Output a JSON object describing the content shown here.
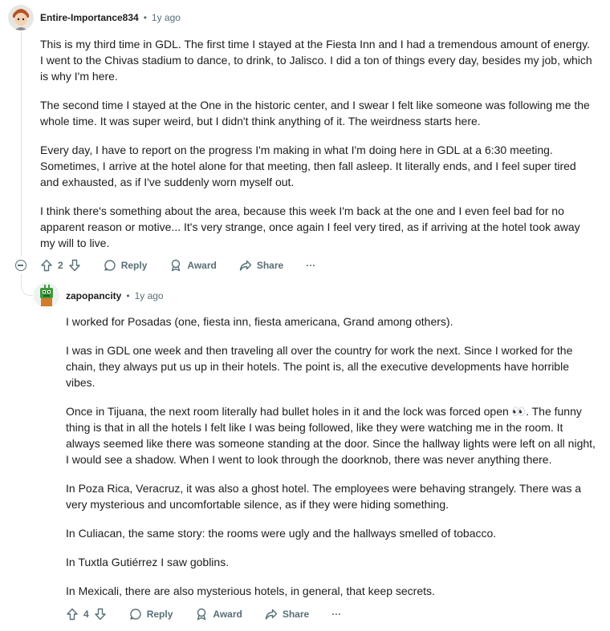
{
  "comment1": {
    "author": "Entire-Importance834",
    "separator": "•",
    "time": "1y ago",
    "paragraphs": [
      "This is my third time in GDL. The first time I stayed at the Fiesta Inn and I had a tremendous amount of energy. I went to the Chivas stadium to dance, to drink, to Jalisco. I did a ton of things every day, besides my job, which is why I'm here.",
      "The second time I stayed at the One in the historic center, and I swear I felt like someone was following me the whole time. It was super weird, but I didn't think anything of it. The weirdness starts here.",
      "Every day, I have to report on the progress I'm making in what I'm doing here in GDL at a 6:30 meeting. Sometimes, I arrive at the hotel alone for that meeting, then fall asleep. It literally ends, and I feel super tired and exhausted, as if I've suddenly worn myself out.",
      "I think there's something about the area, because this week I'm back at the one and I even feel bad for no apparent reason or motive... It's very strange, once again I feel very tired, as if arriving at the hotel took away my will to live."
    ],
    "votes": "2",
    "reply_label": "Reply",
    "award_label": "Award",
    "share_label": "Share",
    "more_label": "···"
  },
  "comment2": {
    "author": "zapopancity",
    "separator": "•",
    "time": "1y ago",
    "paragraphs": [
      "I worked for Posadas (one, fiesta inn, fiesta americana, Grand among others).",
      "I was in GDL one week and then traveling all over the country for work the next. Since I worked for the chain, they always put us up in their hotels. The point is, all the executive developments have horrible vibes.",
      "Once in Tijuana, the next room literally had bullet holes in it and the lock was forced open 👀. The funny thing is that in all the hotels I felt like I was being followed, like they were watching me in the room. It always seemed like there was someone standing at the door. Since the hallway lights were left on all night, I would see a shadow. When I went to look through the doorknob, there was never anything there.",
      "In Poza Rica, Veracruz, it was also a ghost hotel. The employees were behaving strangely. There was a very mysterious and uncomfortable silence, as if they were hiding something.",
      "In Culiacan, the same story: the rooms were ugly and the hallways smelled of tobacco.",
      "In Tuxtla Gutiérrez I saw goblins.",
      "In Mexicali, there are also mysterious hotels, in general, that keep secrets."
    ],
    "votes": "4",
    "reply_label": "Reply",
    "award_label": "Award",
    "share_label": "Share",
    "more_label": "···"
  }
}
